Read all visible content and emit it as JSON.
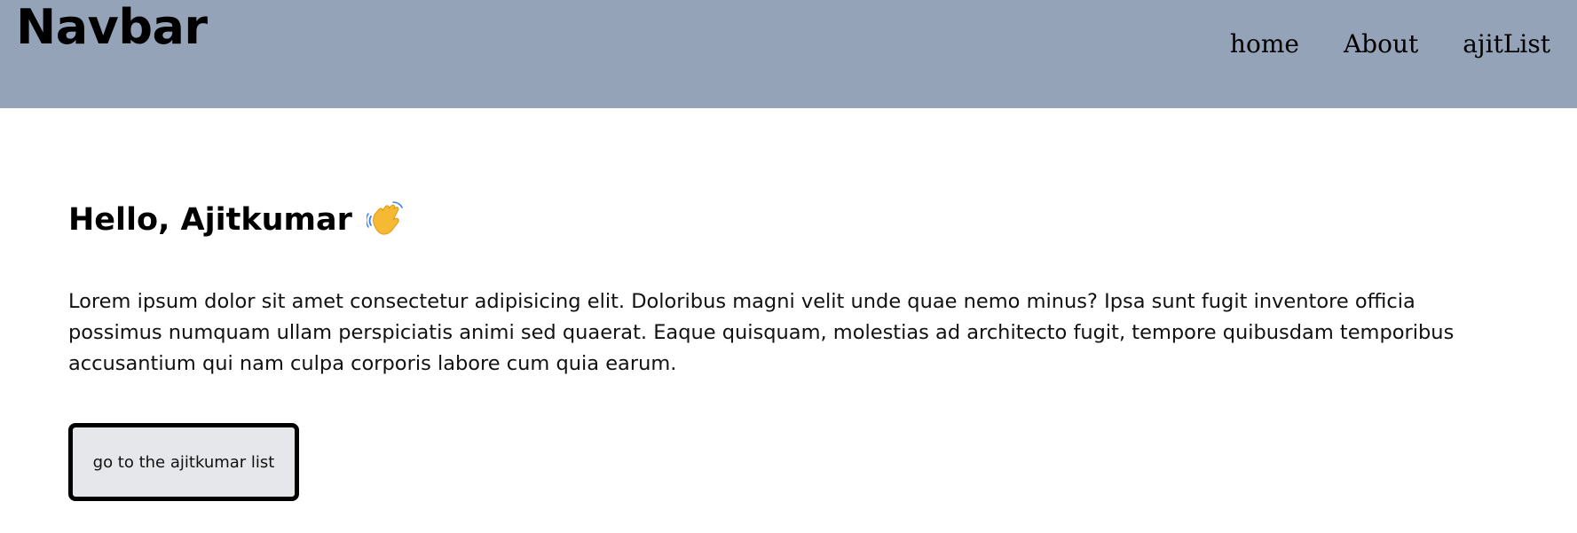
{
  "navbar": {
    "brand": "Navbar",
    "background": "#94a3b8",
    "links": [
      {
        "label": "home"
      },
      {
        "label": "About"
      },
      {
        "label": "ajitList"
      }
    ]
  },
  "main": {
    "greeting": "Hello, Ajitkumar",
    "greeting_icon": "waving-hand-icon",
    "paragraph": "Lorem ipsum dolor sit amet consectetur adipisicing elit. Doloribus magni velit unde quae nemo minus? Ipsa sunt fugit inventore officia possimus numquam ullam perspiciatis animi sed quaerat. Eaque quisquam, molestias ad architecto fugit, tempore quibusdam temporibus accusantium qui nam culpa corporis labore cum quia earum.",
    "button_label": "go to the ajitkumar list"
  }
}
